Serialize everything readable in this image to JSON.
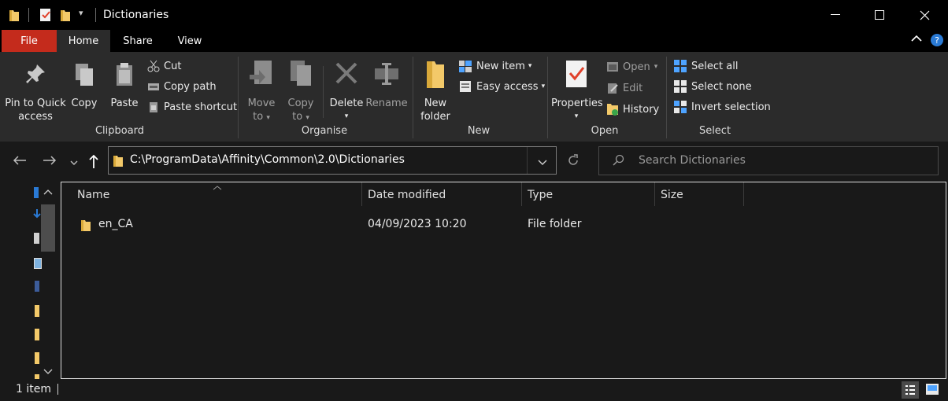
{
  "window": {
    "title": "Dictionaries"
  },
  "tabs": {
    "file": "File",
    "home": "Home",
    "share": "Share",
    "view": "View"
  },
  "ribbon": {
    "clipboard": {
      "label": "Clipboard",
      "pin": [
        "Pin to Quick",
        "access"
      ],
      "copy": "Copy",
      "paste": "Paste",
      "cut": "Cut",
      "copy_path": "Copy path",
      "paste_shortcut": "Paste shortcut"
    },
    "organise": {
      "label": "Organise",
      "move_to": [
        "Move",
        "to"
      ],
      "copy_to": [
        "Copy",
        "to"
      ],
      "delete": "Delete",
      "rename": "Rename"
    },
    "new": {
      "label": "New",
      "new_folder": [
        "New",
        "folder"
      ],
      "new_item": "New item",
      "easy_access": "Easy access"
    },
    "open": {
      "label": "Open",
      "properties": "Properties",
      "open": "Open",
      "edit": "Edit",
      "history": "History"
    },
    "select": {
      "label": "Select",
      "select_all": "Select all",
      "select_none": "Select none",
      "invert_selection": "Invert selection"
    }
  },
  "address": {
    "path": "C:\\ProgramData\\Affinity\\Common\\2.0\\Dictionaries",
    "search_placeholder": "Search Dictionaries"
  },
  "columns": {
    "name": "Name",
    "date_modified": "Date modified",
    "type": "Type",
    "size": "Size"
  },
  "files": [
    {
      "name": "en_CA",
      "date_modified": "04/09/2023 10:20",
      "type": "File folder",
      "size": ""
    }
  ],
  "status": {
    "item_count": "1 item"
  },
  "colors": {
    "file_tab": "#c42b1c",
    "folder": "#f3c969",
    "accent": "#4ea3ff"
  }
}
